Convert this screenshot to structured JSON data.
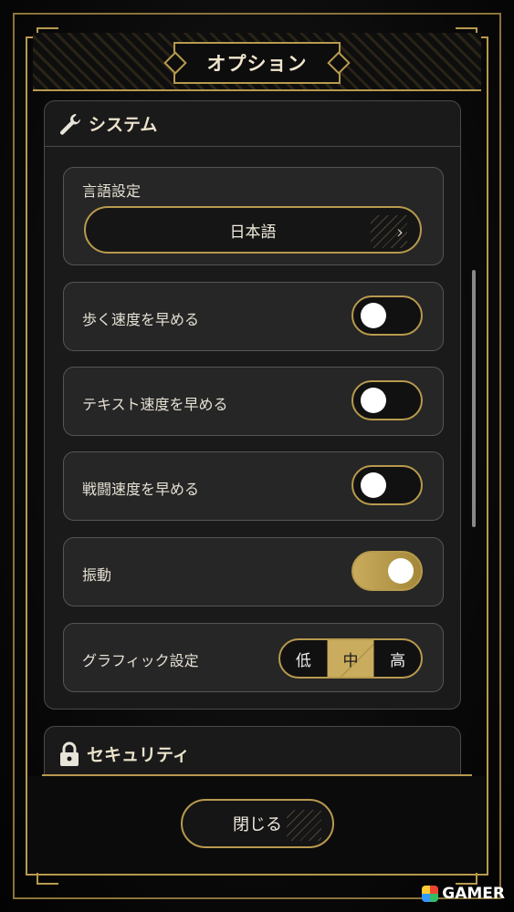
{
  "header": {
    "title": "オプション"
  },
  "system": {
    "section_title": "システム",
    "icon": "wrench-icon",
    "language": {
      "label": "言語設定",
      "value": "日本語"
    },
    "toggles": [
      {
        "label": "歩く速度を早める",
        "on": false
      },
      {
        "label": "テキスト速度を早める",
        "on": false
      },
      {
        "label": "戦闘速度を早める",
        "on": false
      },
      {
        "label": "振動",
        "on": true
      }
    ],
    "graphics": {
      "label": "グラフィック設定",
      "options": [
        "低",
        "中",
        "高"
      ],
      "selected": "中"
    }
  },
  "security": {
    "section_title": "セキュリティ",
    "icon": "lock-icon"
  },
  "footer": {
    "close_label": "閉じる"
  },
  "watermark": {
    "text": "GAMER"
  },
  "colors": {
    "accent": "#b89a4e",
    "panel": "#1a1a1a",
    "card": "#262626"
  }
}
